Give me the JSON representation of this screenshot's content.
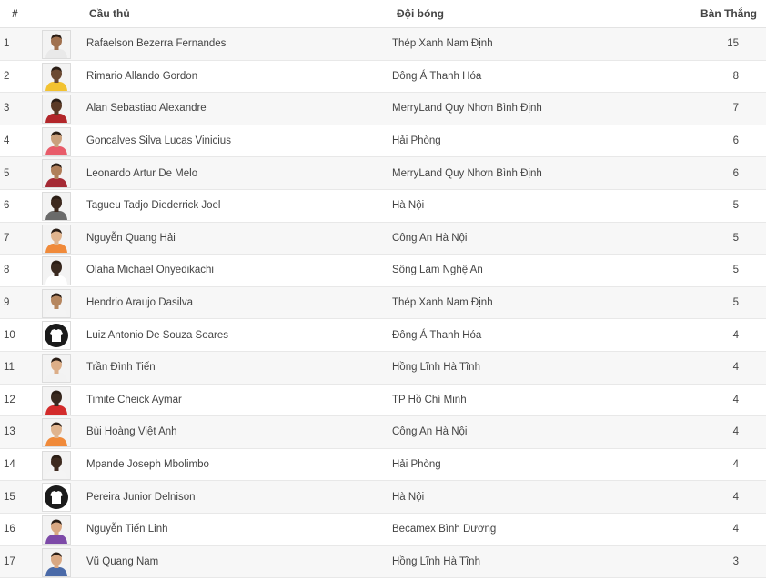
{
  "header": {
    "rank": "#",
    "player": "Cầu thủ",
    "team": "Đội bóng",
    "goals": "Bàn Thắng"
  },
  "rows": [
    {
      "rank": "1",
      "name": "Rafaelson Bezerra Fernandes",
      "team": "Thép Xanh Nam Định",
      "goals": "15",
      "skin": "#a0714f",
      "shirt": "#e9e9e9"
    },
    {
      "rank": "2",
      "name": "Rimario Allando Gordon",
      "team": "Đông Á Thanh Hóa",
      "goals": "8",
      "skin": "#6b4a33",
      "shirt": "#f2c230"
    },
    {
      "rank": "3",
      "name": "Alan Sebastiao Alexandre",
      "team": "MerryLand Quy Nhơn Bình Định",
      "goals": "7",
      "skin": "#5b3a26",
      "shirt": "#b2262a"
    },
    {
      "rank": "4",
      "name": "Goncalves Silva Lucas Vinicius",
      "team": "Hải Phòng",
      "goals": "6",
      "skin": "#caa07c",
      "shirt": "#e85c6a"
    },
    {
      "rank": "5",
      "name": "Leonardo Artur De Melo",
      "team": "MerryLand Quy Nhơn Bình Định",
      "goals": "6",
      "skin": "#b07f5a",
      "shirt": "#a52a35"
    },
    {
      "rank": "6",
      "name": "Tagueu Tadjo Diederrick Joel",
      "team": "Hà Nội",
      "goals": "5",
      "skin": "#3e2a1f",
      "shirt": "#6a6a6a"
    },
    {
      "rank": "7",
      "name": "Nguyễn Quang Hải",
      "team": "Công An Hà Nội",
      "goals": "5",
      "skin": "#e0b48e",
      "shirt": "#f08a3a"
    },
    {
      "rank": "8",
      "name": "Olaha Michael Onyedikachi",
      "team": "Sông Lam Nghệ An",
      "goals": "5",
      "skin": "#3a2a20",
      "shirt": "#ffffff"
    },
    {
      "rank": "9",
      "name": "Hendrio Araujo Dasilva",
      "team": "Thép Xanh Nam Định",
      "goals": "5",
      "skin": "#b5865f",
      "shirt": "#f4f4f4"
    },
    {
      "rank": "10",
      "name": "Luiz Antonio De Souza Soares",
      "team": "Đông Á Thanh Hóa",
      "goals": "4",
      "skin": "",
      "shirt": "",
      "placeholder": true
    },
    {
      "rank": "11",
      "name": "Trần Đình Tiến",
      "team": "Hồng Lĩnh Hà Tĩnh",
      "goals": "4",
      "skin": "#dcae88",
      "shirt": "#f2f2f2"
    },
    {
      "rank": "12",
      "name": "Timite Cheick Aymar",
      "team": "TP Hồ Chí Minh",
      "goals": "4",
      "skin": "#3a2a20",
      "shirt": "#d32b2b"
    },
    {
      "rank": "13",
      "name": "Bùi Hoàng Việt Anh",
      "team": "Công An Hà Nội",
      "goals": "4",
      "skin": "#e0b48e",
      "shirt": "#f08a3a"
    },
    {
      "rank": "14",
      "name": "Mpande Joseph Mbolimbo",
      "team": "Hải Phòng",
      "goals": "4",
      "skin": "#3e2a1f",
      "shirt": "#f4f4f4"
    },
    {
      "rank": "15",
      "name": "Pereira Junior Delnison",
      "team": "Hà Nội",
      "goals": "4",
      "skin": "",
      "shirt": "",
      "placeholder": true
    },
    {
      "rank": "16",
      "name": "Nguyễn Tiến Linh",
      "team": "Becamex Bình Dương",
      "goals": "4",
      "skin": "#d9a883",
      "shirt": "#7d4aa8"
    },
    {
      "rank": "17",
      "name": "Vũ Quang Nam",
      "team": "Hồng Lĩnh Hà Tĩnh",
      "goals": "3",
      "skin": "#d9a883",
      "shirt": "#4a6aa8"
    }
  ]
}
